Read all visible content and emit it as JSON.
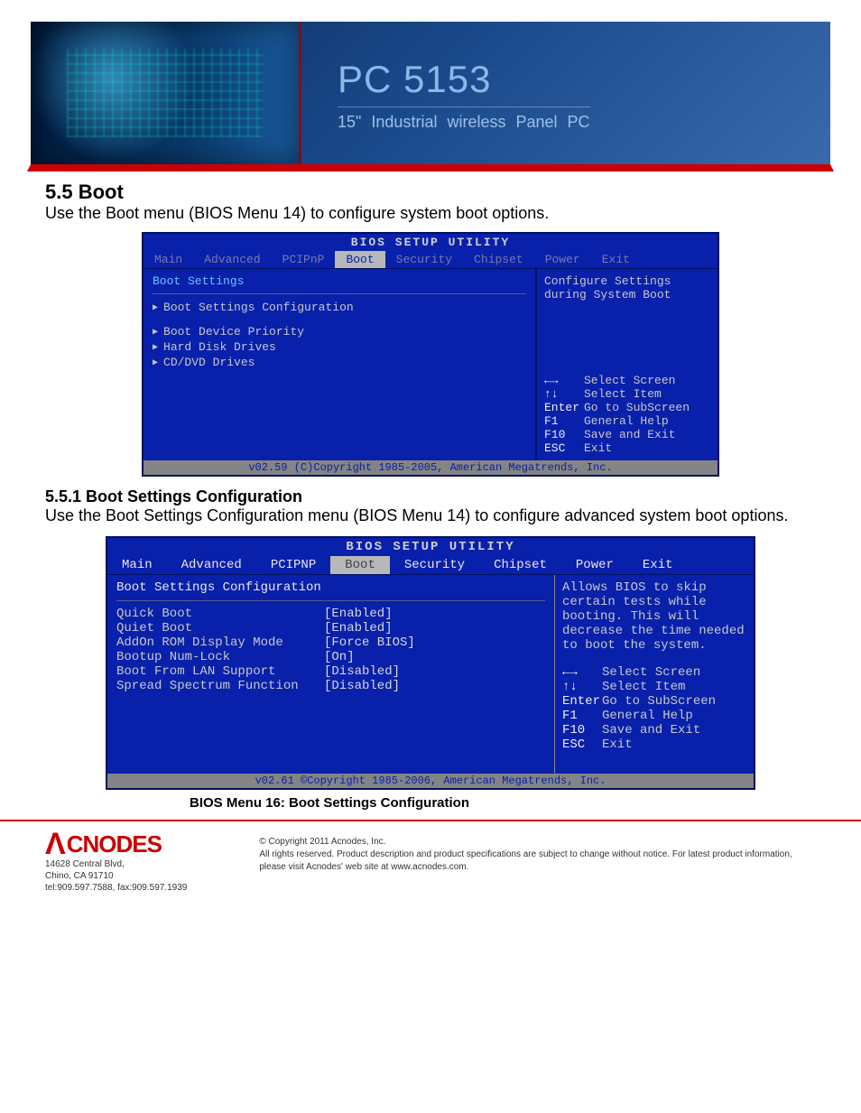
{
  "banner": {
    "product_name": "PC 5153",
    "product_sub": "15\" Industrial wireless Panel PC"
  },
  "section": {
    "number_title": "5.5  Boot",
    "intro": "Use the Boot menu (BIOS Menu 14) to configure system boot options."
  },
  "bios1": {
    "title": "BIOS SETUP UTILITY",
    "tabs": [
      "Main",
      "Advanced",
      "PCIPnP",
      "Boot",
      "Security",
      "Chipset",
      "Power",
      "Exit"
    ],
    "active_tab": "Boot",
    "left": {
      "heading": "Boot Settings",
      "items": [
        "Boot Settings Configuration",
        "Boot Device Priority",
        "Hard Disk Drives",
        "CD/DVD Drives"
      ]
    },
    "right": {
      "help1": "Configure Settings during System Boot",
      "keys": [
        {
          "k": "←→",
          "t": "Select Screen"
        },
        {
          "k": "↑↓",
          "t": "Select Item"
        },
        {
          "k": "Enter",
          "t": "Go to SubScreen"
        },
        {
          "k": "F1",
          "t": "General Help"
        },
        {
          "k": "F10",
          "t": "Save and Exit"
        },
        {
          "k": "ESC",
          "t": "Exit"
        }
      ]
    },
    "copyright": "v02.59 (C)Copyright 1985-2005, American Megatrends, Inc."
  },
  "subsection": {
    "title": "5.5.1 Boot Settings Configuration",
    "intro": "Use the Boot Settings Configuration menu (BIOS Menu 14) to configure advanced system boot options."
  },
  "bios2": {
    "title": "BIOS SETUP UTILITY",
    "tabs": [
      "Main",
      "Advanced",
      "PCIPNP",
      "Boot",
      "Security",
      "Chipset",
      "Power",
      "Exit"
    ],
    "active_tab": "Boot",
    "heading": "Boot Settings Configuration",
    "settings": [
      {
        "label": "Quick Boot",
        "value": "[Enabled]"
      },
      {
        "label": "Quiet Boot",
        "value": "[Enabled]"
      },
      {
        "label": "AddOn ROM Display Mode",
        "value": "[Force BIOS]"
      },
      {
        "label": "Bootup Num-Lock",
        "value": "[On]"
      },
      {
        "label": "Boot From LAN Support",
        "value": "[Disabled]"
      },
      {
        "label": "Spread Spectrum Function",
        "value": "[Disabled]"
      }
    ],
    "right_help": "Allows BIOS to skip certain tests while booting. This will decrease the time needed to boot the system.",
    "keys": [
      {
        "k": "←→",
        "t": "Select Screen"
      },
      {
        "k": "↑↓",
        "t": "Select Item"
      },
      {
        "k": "Enter",
        "t": "Go to SubScreen"
      },
      {
        "k": "F1",
        "t": "General Help"
      },
      {
        "k": "F10",
        "t": "Save and Exit"
      },
      {
        "k": "ESC",
        "t": "Exit"
      }
    ],
    "copyright": "v02.61 ©Copyright 1985-2006, American Megatrends, Inc."
  },
  "caption": "BIOS Menu 16: Boot Settings Configuration",
  "footer": {
    "brand": "CNODES",
    "addr1": "14628 Central Blvd,",
    "addr2": "Chino, CA 91710",
    "phone": "tel:909.597.7588, fax:909.597.1939",
    "copy": "© Copyright 2011 Acnodes, Inc.\nAll rights reserved. Product description and product specifications are subject to change without notice. For latest product information, please visit Acnodes' web site at www.acnodes.com."
  }
}
